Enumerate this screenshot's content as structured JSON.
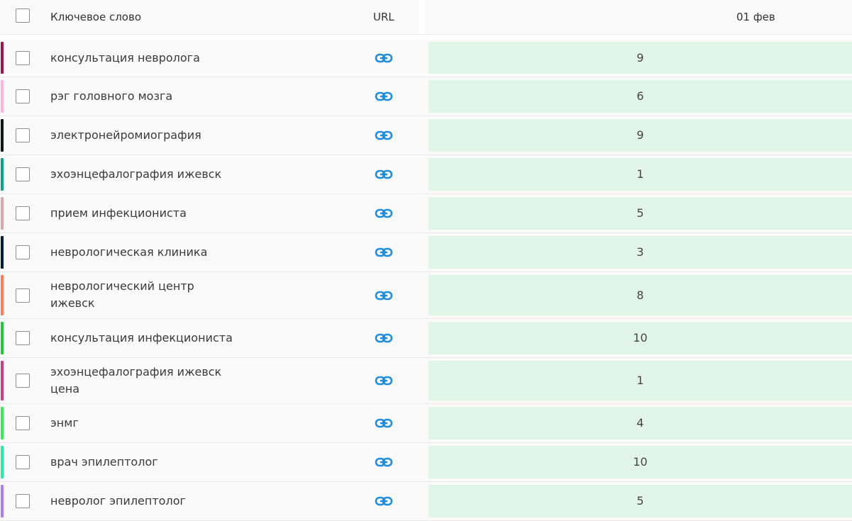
{
  "header": {
    "keyword_label": "Ключевое слово",
    "url_label": "URL",
    "date_label": "01 фев"
  },
  "link_icon_color": "#1f8de0",
  "cell_bg_color": "#e2f6e8",
  "rows": [
    {
      "keyword": "консультация невролога",
      "value": "9",
      "color": "#a0124a"
    },
    {
      "keyword": "рэг головного мозга",
      "value": "6",
      "color": "#ffb3d6"
    },
    {
      "keyword": "электронейромиография",
      "value": "9",
      "color": "#0a1a10"
    },
    {
      "keyword": "эхоэнцефалография ижевск",
      "value": "1",
      "color": "#08a58e"
    },
    {
      "keyword": "прием инфекциониста",
      "value": "5",
      "color": "#d9a9a9"
    },
    {
      "keyword": "неврологическая клиника",
      "value": "3",
      "color": "#0a1a3a"
    },
    {
      "keyword": "неврологический центр ижевск",
      "value": "8",
      "color": "#ff7a55"
    },
    {
      "keyword": "консультация инфекциониста",
      "value": "10",
      "color": "#22cc33"
    },
    {
      "keyword": "эхоэнцефалография ижевск цена",
      "value": "1",
      "color": "#cc3a8a"
    },
    {
      "keyword": "энмг",
      "value": "4",
      "color": "#33ee55"
    },
    {
      "keyword": "врач эпилептолог",
      "value": "10",
      "color": "#22ee99"
    },
    {
      "keyword": "невролог эпилептолог",
      "value": "5",
      "color": "#b07aff"
    }
  ]
}
